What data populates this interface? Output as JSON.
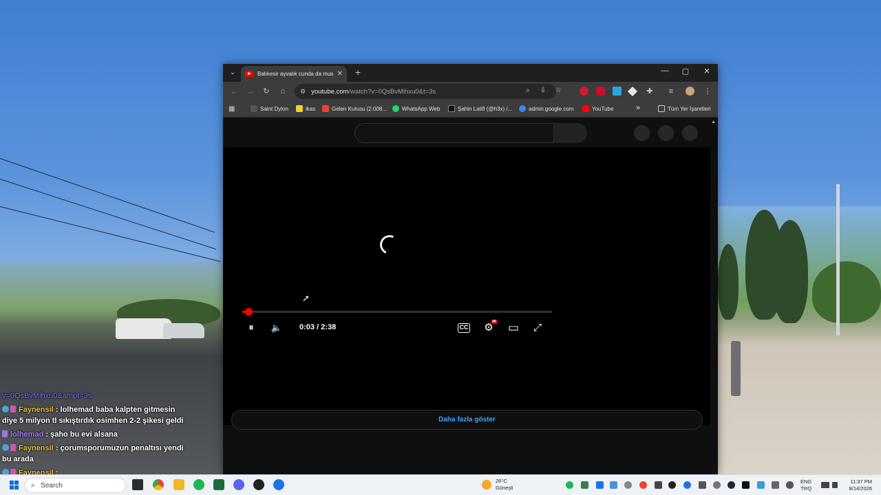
{
  "browser": {
    "tab_title": "Balıkesir ayvalık cunda da must",
    "url_host": "youtube.com",
    "url_path": "/watch?v=0QsBvMihxu0&t=3s",
    "bookmarks": [
      "Saint Dylon",
      "ikas",
      "Gelen Kutusu (2.008...",
      "WhatsApp Web",
      "Şahin Latifi (@h3x) /...",
      "admin.google.com",
      "YouTube"
    ],
    "all_bookmarks_label": "Tüm Yer İşaretleri",
    "overflow_label": "»"
  },
  "player": {
    "time_display": "0:03 / 2:38",
    "progress_fraction": 0.019,
    "show_more_label": "Daha fazla göster",
    "quality_badge": "4K"
  },
  "chat": {
    "url_line": "v=0QsBvMihxu0&ampt=3s",
    "messages": [
      {
        "user": "Faynensil",
        "text": ": lolhemad baba kalpten gitmesin",
        "cont": "diye 5 milyon tl sıkıştırdık osimhen 2-2 şikesi geldi"
      },
      {
        "user": "lolhemad",
        "text": ": şaho bu evi alsana"
      },
      {
        "user": "Faynensil",
        "text": ": çorumsporumuzun penaltısı yendi",
        "cont": "bu arada"
      },
      {
        "user": "Faynensil",
        "text": ":"
      }
    ]
  },
  "taskbar": {
    "search_placeholder": "Search",
    "weather_temp": "26°C",
    "weather_desc": "Güneşli",
    "lang_top": "ENG",
    "lang_bottom": "TRQ",
    "time": "11:37 PM",
    "date": "8/14/2026"
  },
  "icons": {
    "pause": "⏸",
    "volume": "🔈",
    "subtitles": "CC",
    "settings": "⚙",
    "theater": "▭",
    "fullscreen": "⤢"
  }
}
